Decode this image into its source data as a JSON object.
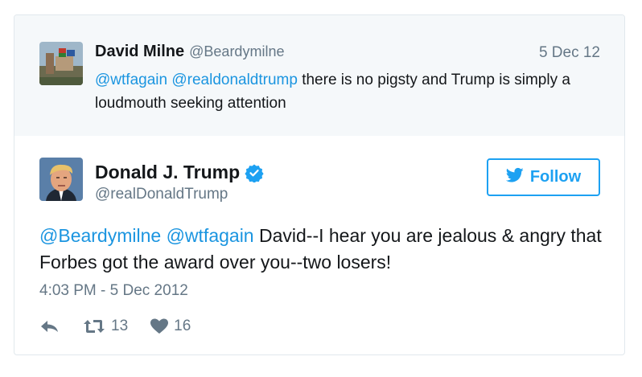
{
  "reply_context": {
    "name": "David Milne",
    "handle": "@Beardymilne",
    "date": "5 Dec 12",
    "mention_1": "@wtfagain",
    "mention_2": "@realdonaldtrump",
    "text_rest": " there is no pigsty and Trump is simply a loudmouth seeking attention"
  },
  "tweet": {
    "name": "Donald J. Trump",
    "handle": "@realDonaldTrump",
    "follow_label": "Follow",
    "mention_1": "@Beardymilne",
    "mention_2": "@wtfagain",
    "text_rest": " David--I hear you are jealous & angry that Forbes got the award over you--two losers!",
    "timestamp": "4:03 PM - 5 Dec 2012",
    "retweets": "13",
    "likes": "16"
  },
  "icons": {
    "verified": "verified-badge-icon",
    "follow_bird": "twitter-bird-icon",
    "reply": "reply-icon",
    "retweet": "retweet-icon",
    "like": "heart-icon"
  },
  "colors": {
    "accent": "#1da1f2",
    "mention": "#1b95e0",
    "muted": "#657786",
    "context_bg": "#f5f8fa",
    "border": "#e1e8ed"
  }
}
